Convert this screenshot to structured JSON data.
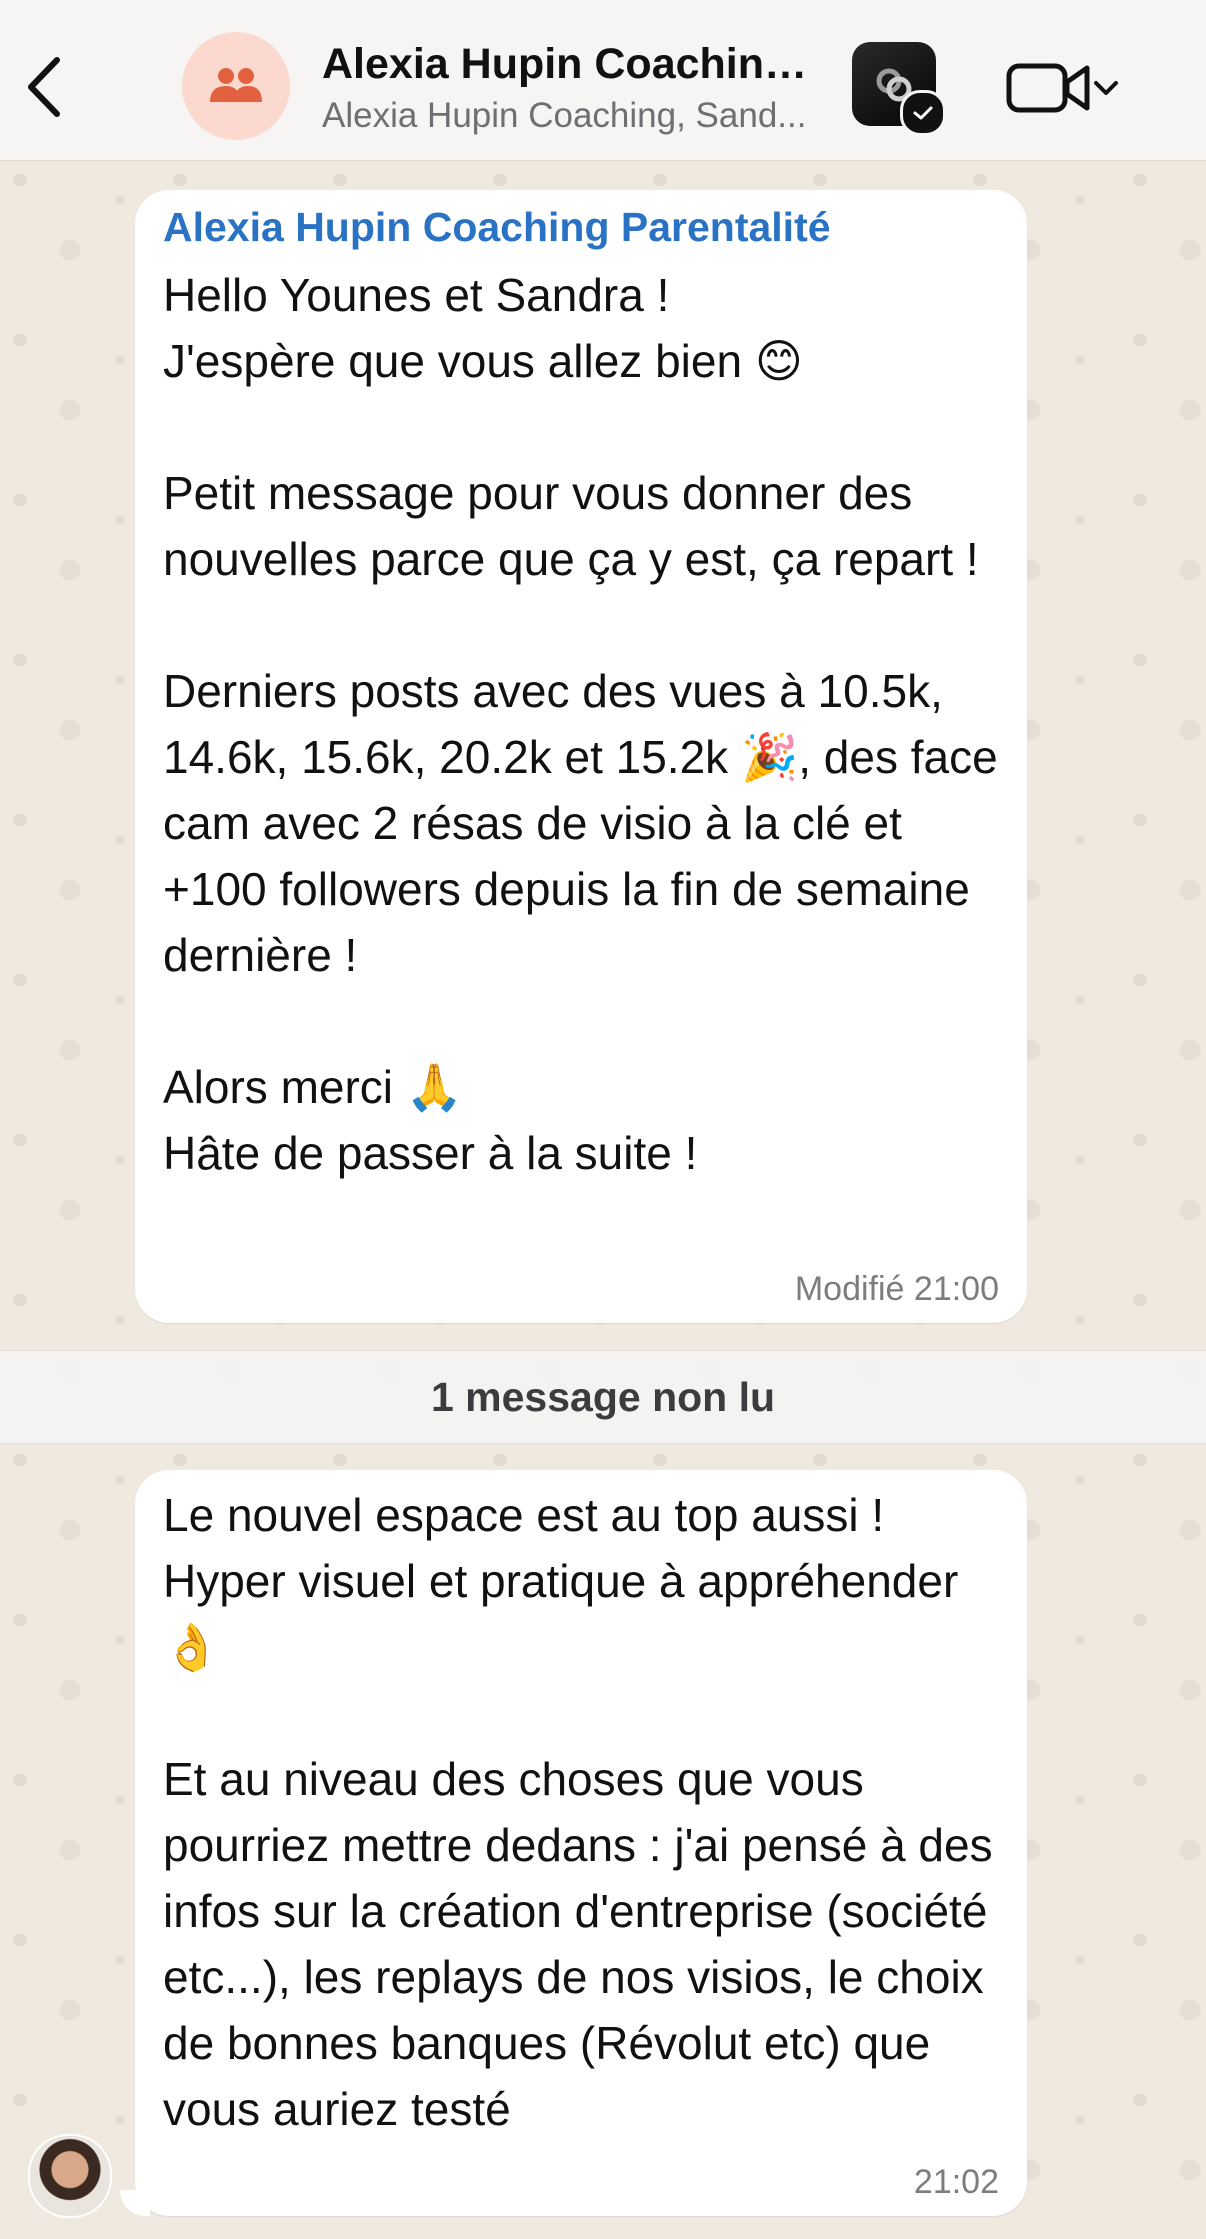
{
  "header": {
    "title": "Alexia Hupin Coaching...",
    "subtitle": "Alexia Hupin Coaching, Sand...",
    "icons": [
      "back-icon",
      "group-icon",
      "app-icon",
      "check-badge-icon",
      "video-call-icon",
      "chevron-down-icon"
    ]
  },
  "messages": [
    {
      "sender": "Alexia Hupin Coaching Parentalité",
      "text": "Hello Younes et Sandra !\nJ'espère que vous allez bien 😊\n\nPetit message pour vous donner des nouvelles parce que ça y est, ça repart !\n\nDerniers posts avec des vues à 10.5k, 14.6k, 15.6k, 20.2k et 15.2k 🎉, des face cam avec 2 résas de visio à la clé et +100 followers depuis la fin de semaine dernière !\n\nAlors merci 🙏\nHâte de passer à la suite !",
      "time": "Modifié 21:00"
    },
    {
      "text": "Le nouvel espace est au top aussi ! Hyper visuel et pratique à appréhender 👌\n\nEt au niveau des choses que vous pourriez mettre dedans : j'ai pensé à des infos sur la création d'entreprise (société etc...), les replays de nos visios, le choix de bonnes banques (Révolut etc) que vous auriez testé",
      "time": "21:02"
    }
  ],
  "unread": {
    "label": "1 message non lu"
  },
  "colors": {
    "sender_name": "#2a73c4",
    "group_avatar_bg": "#fbd9cf",
    "group_avatar_fg": "#e2623f",
    "chat_bg": "#efe9e0"
  }
}
